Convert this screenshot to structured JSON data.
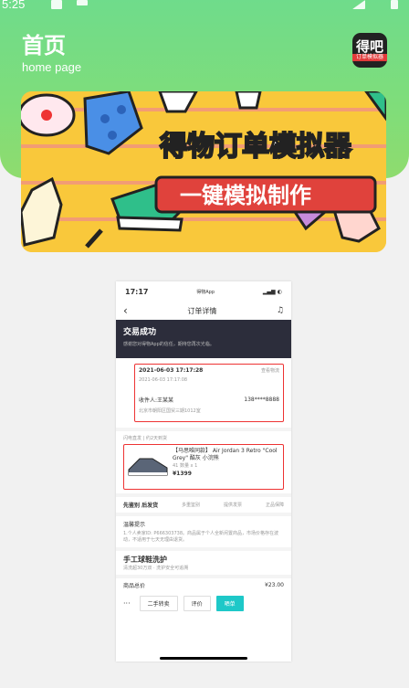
{
  "status_bar": {
    "time": "5:25"
  },
  "header": {
    "title": "首页",
    "subtitle": "home page",
    "app_icon_text": "得吧",
    "app_icon_subtext": "订单模拟器"
  },
  "banner": {
    "line1": "得物订单模拟器",
    "line2": "一键模拟制作"
  },
  "phone": {
    "status_time": "17:17",
    "status_app": "得物App",
    "nav_title": "订单详情",
    "banner_title": "交易成功",
    "banner_sub": "感谢您对得物App的信任，期待您再次光临。",
    "ship_time1": "2021-06-03  17:17:28",
    "ship_link": "查看物流",
    "ship_time2": "2021-06-03  17:17:08",
    "receiver": "收件人:王某某",
    "phone_no": "138****8888",
    "address": "北京市朝阳区国贸三期1012室",
    "shop_label": "闪电直发 | 约2天到货",
    "product_name": "【马思唯同款】 Air Jordan 3 Retro \"Cool Grey\" 酷灰 小浣熊",
    "product_spec": "41  数量 x 1",
    "product_price": "¥1399",
    "services": "先鉴别 后发货",
    "svc1": "多重鉴别",
    "svc2": "提供发票",
    "svc3": "正品保障",
    "note_title": "温馨提示",
    "note_text": "1.个人卖家ID: P666303738。商品属于个人全新闲置商品，市场价格存在波动，不适用于七天无理由退货。",
    "care_title": "手工球鞋洗护",
    "care_sub": "清洗超30万双 · 洗护安全可追溯",
    "total_label": "商品总价",
    "total_value": "¥23.00",
    "btn1": "二手转卖",
    "btn2": "评价",
    "btn3": "晒单"
  }
}
